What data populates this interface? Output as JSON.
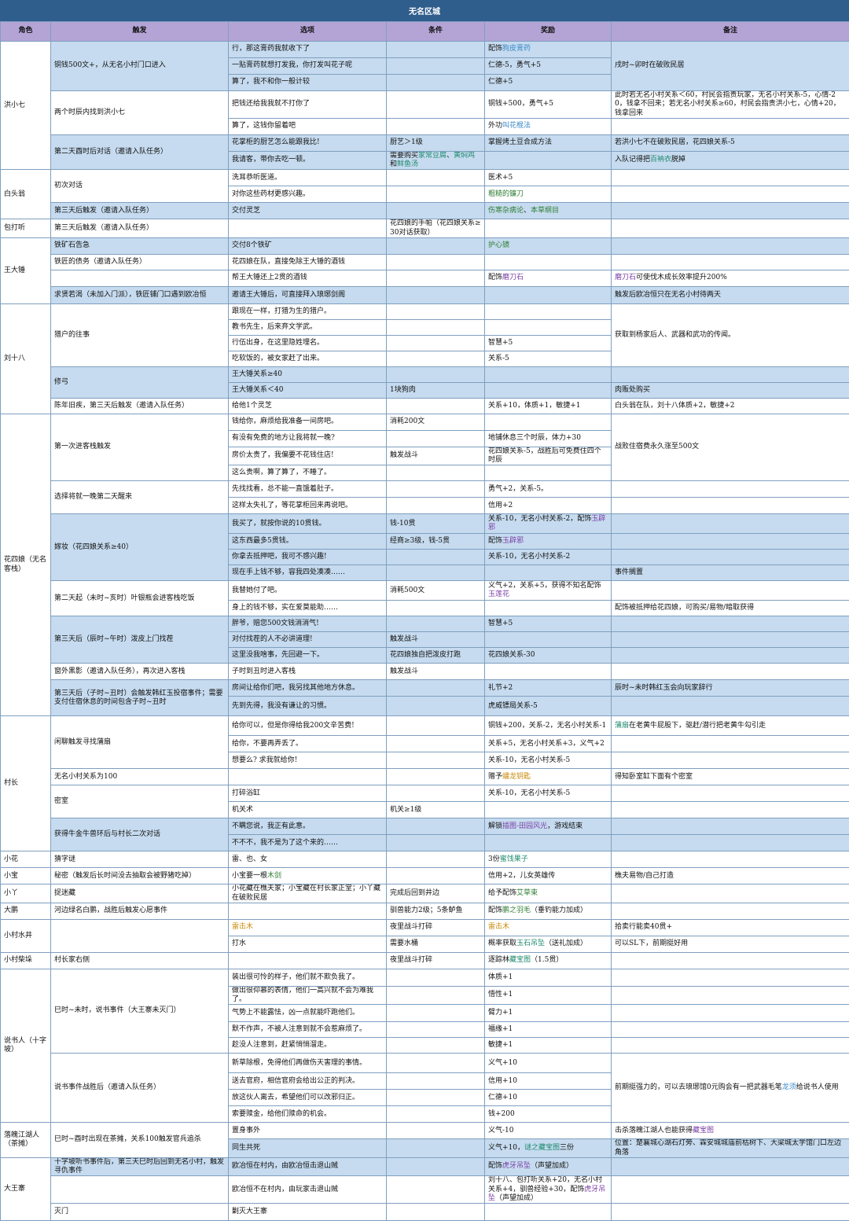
{
  "title": "无名区城",
  "columns": [
    "角色",
    "触发",
    "选项",
    "条件",
    "奖励",
    "备注"
  ],
  "roles": {
    "hong": "洪小七",
    "bai": "白头翁",
    "bao": "包打听",
    "wang": "王大锤",
    "liu": "刘十八",
    "hua": "花四娘（无名客栈）",
    "cun": "村长",
    "xiaohua": "小花",
    "xiaobao": "小宝",
    "xiaoya": "小丫",
    "dapeng": "大鹏",
    "shui": "小村水井",
    "chai": "小村柴垛",
    "shuo": "说书人（十字坡）",
    "luopo": "落魄江湖人（茶摊）",
    "dawang": "大王寨"
  },
  "rows": [
    {
      "t": "铜钱500文+，从无名小村门口进入",
      "o": "行，那这膏药我就收下了",
      "c": "",
      "r": [
        "配饰",
        {
          "s": "狗皮膏药",
          "k": "blue"
        }
      ],
      "n": "戌时~卯时在破败民居"
    },
    {
      "t": "",
      "o": "一贴膏药就想打发我，你打发叫花子呢",
      "c": "",
      "r": "仁德-5，勇气+5",
      "n": ""
    },
    {
      "t": "",
      "o": "算了，我不和你一般计较",
      "c": "",
      "r": "仁德+5",
      "n": ""
    },
    {
      "t": "两个时辰内找到洪小七",
      "o": "把钱还给我我就不打你了",
      "c": "",
      "r": "铜钱+500，勇气+5",
      "n": "此时若无名小村关系＜60，村民会指责玩家，无名小村关系-5，心情-20，钱拿不回来；若无名小村关系≥60，村民会指责洪小七，心情+20，钱拿回来"
    },
    {
      "t": "",
      "o": "算了，这钱你留着吧",
      "c": "",
      "r": [
        "外功",
        {
          "s": "叫花棍法",
          "k": "blue"
        }
      ],
      "n": ""
    },
    {
      "t": "第二天酉时后对话（邀请入队任务）",
      "o": "花掌柜的厨艺怎么能跟我比!",
      "c": "厨艺＞1级",
      "r": "掌握烤土豆合成方法",
      "n": "若洪小七不在破败民居，花四娘关系-5"
    },
    {
      "t": "",
      "o": "我请客，带你去吃一顿。",
      "c": [
        "需要购买",
        {
          "s": "家常豆腐",
          "k": "teal"
        },
        "、",
        {
          "s": "黄焖鸡",
          "k": "teal"
        },
        "和",
        {
          "s": "鲜鱼汤",
          "k": "teal"
        }
      ],
      "r": "",
      "n": [
        "入队记得把",
        {
          "s": "百衲衣",
          "k": "teal"
        },
        "脱掉"
      ]
    },
    {
      "t": "初次对话",
      "o": "洗耳恭听医道。",
      "c": "",
      "r": "医术+5",
      "n": ""
    },
    {
      "t": "",
      "o": "对你这些药材更感兴趣。",
      "c": "",
      "r": [
        {
          "s": "粗糙的镰刀",
          "k": "green"
        }
      ],
      "n": ""
    },
    {
      "t": "第三天后触发（邀请入队任务）",
      "o": "交付灵芝",
      "c": "",
      "r": [
        {
          "s": "伤寒杂病论",
          "k": "green"
        },
        "、",
        {
          "s": "本草纲目",
          "k": "green"
        }
      ],
      "n": ""
    },
    {
      "t": "第三天后触发（邀请入队任务）",
      "o": "",
      "c": "花四娘的手帕（花四娘关系≥30对话获取）",
      "r": "",
      "n": ""
    },
    {
      "t": "铁矿石告急",
      "o": "交付8个铁矿",
      "c": "",
      "r": [
        {
          "s": "护心镜",
          "k": "green"
        }
      ],
      "n": ""
    },
    {
      "t": "铁匠的债务（邀请入队任务）",
      "o": "花四娘在队，直接免除王大锤的酒钱",
      "c": "",
      "r": "",
      "n": ""
    },
    {
      "t": "",
      "o": "帮王大锤还上2贯的酒钱",
      "c": "",
      "r": [
        "配饰",
        {
          "s": "磨刀石",
          "k": "purple"
        }
      ],
      "n": [
        {
          "s": "磨刀石",
          "k": "purple"
        },
        "可使伐木成长效率提升200%"
      ]
    },
    {
      "t": "求贤若渴（未加入门派），铁匠铺门口遇到欧冶恒",
      "o": "邀请王大锤后，可直接拜入琅琊剑阁",
      "c": "",
      "r": "",
      "n": "触发后欧冶恒只在无名小村待两天"
    },
    {
      "t": "猎户的往事",
      "o": "跟现在一样，打猎为生的猎户。",
      "c": "",
      "r": "",
      "n": "获取到杨家后人、武器和武功的传闻。"
    },
    {
      "t": "",
      "o": "教书先生，后来弃文学武。",
      "c": "",
      "r": "",
      "n": ""
    },
    {
      "t": "",
      "o": "行伍出身，在这里隐姓埋名。",
      "c": "",
      "r": "智慧+5",
      "n": ""
    },
    {
      "t": "",
      "o": "吃软饭的，被女家赶了出来。",
      "c": "",
      "r": "关系-5",
      "n": ""
    },
    {
      "t": "修弓",
      "o": "王大锤关系≥40",
      "c": "",
      "r": "",
      "n": ""
    },
    {
      "t": "",
      "o": "王大锤关系＜40",
      "c": "1块狗肉",
      "r": "",
      "n": "肉贩处购买"
    },
    {
      "t": "陈年旧疾，第三天后触发（邀请入队任务）",
      "o": "给他1个灵芝",
      "c": "",
      "r": "关系+10，体质+1，敏捷+1",
      "n": "白头翁在队，刘十八体质+2，敏捷+2"
    },
    {
      "t": "第一次进客栈触发",
      "o": "钱给你，麻烦给我准备一间房吧。",
      "c": "消耗200文",
      "r": "",
      "n": "战败住宿费永久涨至500文"
    },
    {
      "t": "",
      "o": "有没有免费的地方让我将就一晚?",
      "c": "",
      "r": "地铺休息三个时辰，体力+30",
      "n": ""
    },
    {
      "t": "",
      "o": "房价太贵了，我偏要不花钱住店!",
      "c": "触发战斗",
      "r": "花四娘关系-5，战胜后可免费住四个时辰",
      "n": ""
    },
    {
      "t": "",
      "o": "这么贵啊，算了算了，不睡了。",
      "c": "",
      "r": "",
      "n": ""
    },
    {
      "t": "选择将就一晚第二天醒来",
      "o": "先找找看，总不能一直饿着肚子。",
      "c": "",
      "r": "勇气+2，关系-5。",
      "n": ""
    },
    {
      "t": "",
      "o": "这样太失礼了，等花掌柜回来再说吧。",
      "c": "",
      "r": "信用+2",
      "n": ""
    },
    {
      "t": "嫁妆（花四娘关系≥40）",
      "o": "我买了，就按你说的10贯钱。",
      "c": "钱-10贯",
      "r": [
        "关系-10，无名小村关系-2，配饰",
        {
          "s": "玉辟邪",
          "k": "purple"
        }
      ],
      "n": ""
    },
    {
      "t": "",
      "o": "这东西最多5贯钱。",
      "c": "经商≥3级，钱-5贯",
      "r": [
        "配饰",
        {
          "s": "玉辟邪",
          "k": "purple"
        }
      ],
      "n": ""
    },
    {
      "t": "",
      "o": "你拿去抵押吧，我可不感兴趣!",
      "c": "",
      "r": "关系-10，无名小村关系-2",
      "n": ""
    },
    {
      "t": "",
      "o": "现在手上钱不够，容我四处凑凑……",
      "c": "",
      "r": "",
      "n": "事件搁置"
    },
    {
      "t": "第二天起（未时~亥时）叶银瓶会进客栈吃饭",
      "o": "我替她付了吧。",
      "c": "消耗500文",
      "r": [
        "义气+2，关系+5，获得不知名配饰",
        {
          "s": "玉莲花",
          "k": "purple"
        }
      ],
      "n": ""
    },
    {
      "t": "",
      "o": "身上的钱不够，实在爱莫能助……",
      "c": "",
      "r": "",
      "n": "配饰被抵押给花四娘，可购买/易物/暗取获得"
    },
    {
      "t": "第三天后（辰时~午时）泼皮上门找茬",
      "o": "胖爷，赔您500文钱消消气!",
      "c": "",
      "r": "智慧+5",
      "n": ""
    },
    {
      "t": "",
      "o": "对付找茬的人不必讲道理!",
      "c": "触发战斗",
      "r": "",
      "n": ""
    },
    {
      "t": "",
      "o": "这里没我啥事，先回避一下。",
      "c": "花四娘独自把泼皮打跑",
      "r": "花四娘关系-30",
      "n": ""
    },
    {
      "t": "窗外黑影（邀请入队任务），再次进入客栈",
      "o": "子时到丑时进入客栈",
      "c": "触发战斗",
      "r": "",
      "n": ""
    },
    {
      "t": "第三天后（子时~丑时）会触发韩红玉投宿事件；需要支付住宿休息的时间包含子时~丑时",
      "o": "房间让给你们吧，我另找其他地方休息。",
      "c": "",
      "r": "礼节+2",
      "n": "辰时~未时韩红玉会向玩家辞行"
    },
    {
      "t": "",
      "o": "先到先得，我没有谦让的习惯。",
      "c": "",
      "r": "虎威镖局关系-5",
      "n": ""
    },
    {
      "t": "闲聊触发寻找蒲扇",
      "o": "给你可以，但是你得给我200文辛苦费!",
      "c": "",
      "r": "铜钱+200，关系-2，无名小村关系-1",
      "n": [
        {
          "s": "蒲扇",
          "k": "teal"
        },
        "在老黄牛屁股下，驱赶/潜行把老黄牛勾引走"
      ]
    },
    {
      "t": "",
      "o": "给你，不要再弄丢了。",
      "c": "",
      "r": "关系+5，无名小村关系+3，义气+2",
      "n": ""
    },
    {
      "t": "",
      "o": "想要么? 求我就给你!",
      "c": "",
      "r": "关系-10，无名小村关系-5",
      "n": ""
    },
    {
      "t": "无名小村关系为100",
      "o": "",
      "c": "",
      "r": [
        "赠予",
        {
          "s": "蟠龙钥匙",
          "k": "orange"
        }
      ],
      "n": "得知卧室缸下面有个密室"
    },
    {
      "t": "密室",
      "o": "打碎浴缸",
      "c": "",
      "r": "关系-10，无名小村关系-5",
      "n": ""
    },
    {
      "t": "",
      "o": "机关术",
      "c": "机关≥1级",
      "r": "",
      "n": ""
    },
    {
      "t": "获得牛金牛兽环后与村长二次对话",
      "o": "不瞒您说，我正有此意。",
      "c": "",
      "r": [
        "解锁",
        {
          "s": "插图-田园风光",
          "k": "purple"
        },
        "，游戏结束"
      ],
      "n": ""
    },
    {
      "t": "",
      "o": "不不不，我不是为了这个来的……",
      "c": "",
      "r": "",
      "n": ""
    },
    {
      "t": "猜字谜",
      "o": "雷、也、女",
      "c": "",
      "r": [
        "3份",
        {
          "s": "蜜饯果子",
          "k": "teal"
        }
      ],
      "n": ""
    },
    {
      "t": "秘密（触发后长时间没去抽取会被野猪吃掉）",
      "o": [
        "小宝要一根",
        {
          "s": "木剑",
          "k": "green"
        }
      ],
      "c": "",
      "r": "信用+2，儿女英雄传",
      "n": "樵夫易物/自己打造"
    },
    {
      "t": "捉迷藏",
      "o": "小花藏在樵夫家；小宝藏在村长家正堂；小丫藏在破败民居",
      "c": "完成后回到井边",
      "r": [
        "给予配饰",
        {
          "s": "艾草束",
          "k": "green"
        }
      ],
      "n": ""
    },
    {
      "t": "河边绿名白鹏，战胜后触发心愿事件",
      "o": "",
      "c": "驯兽能力2级；5条鲈鱼",
      "r": [
        "配饰",
        {
          "s": "鹏之羽毛",
          "k": "green"
        },
        "（垂钓能力加成）"
      ],
      "n": ""
    },
    {
      "t": "",
      "o": [
        {
          "s": "雷击木",
          "k": "orange"
        }
      ],
      "c": "夜里战斗打碎",
      "r": [
        {
          "s": "雷击木",
          "k": "orange"
        }
      ],
      "n": "拾卖行能卖40贯+"
    },
    {
      "t": "",
      "o": "打水",
      "c": "需要水桶",
      "r": [
        "概率获取",
        {
          "s": "玉石吊坠",
          "k": "teal"
        },
        "（送礼加成）"
      ],
      "n": "可以SL下，前期挺好用"
    },
    {
      "t": "村长家右侧",
      "o": "",
      "c": "夜里战斗打碎",
      "r": [
        "逐踪林",
        {
          "s": "藏宝图",
          "k": "teal"
        },
        "（1.5贯）"
      ],
      "n": ""
    },
    {
      "t": "巳时~未时，说书事件（大王寨未灭门）",
      "o": "装出很可怜的样子，他们就不欺负我了。",
      "c": "",
      "r": "体质+1",
      "n": ""
    },
    {
      "t": "",
      "o": "做出很仰慕的表情，他们一高兴就不会为难我了。",
      "c": "",
      "r": "悟性+1",
      "n": ""
    },
    {
      "t": "",
      "o": "气势上不能露怯，凶一点就能吓跑他们。",
      "c": "",
      "r": "臂力+1",
      "n": ""
    },
    {
      "t": "",
      "o": "默不作声，不被人注意到就不会惹麻烦了。",
      "c": "",
      "r": "福缘+1",
      "n": ""
    },
    {
      "t": "",
      "o": "趁没人注意到，赶紧悄悄溜走。",
      "c": "",
      "r": "敏捷+1",
      "n": ""
    },
    {
      "t": "说书事件战胜后（邀请入队任务）",
      "o": "新草除根，免得他们再做伤天害理的事情。",
      "c": "",
      "r": "义气+10",
      "n": [
        "前期挺强力的，可以去琅琊馆0元购会有一把武器毛笔",
        {
          "s": "龙须",
          "k": "blue"
        },
        "给说书人使用"
      ]
    },
    {
      "t": "",
      "o": "送去官府，相信官府会给出公正的判决。",
      "c": "",
      "r": "信用+10",
      "n": ""
    },
    {
      "t": "",
      "o": "放这伙人离去，希望他们可以改邪归正。",
      "c": "",
      "r": "仁德+10",
      "n": ""
    },
    {
      "t": "",
      "o": "索要赎金，给他们赎命的机会。",
      "c": "",
      "r": "钱+200",
      "n": ""
    },
    {
      "t": "巳时~酉时出现在茶摊，关系100触发官兵追杀",
      "o": "置身事外",
      "c": "",
      "r": "义气-10",
      "n": [
        "击杀落魄江湖人也能获得",
        {
          "s": "藏宝图",
          "k": "purple"
        }
      ]
    },
    {
      "t": "",
      "o": "同生共死",
      "c": "",
      "r": [
        "义气+10，",
        {
          "s": "谜之藏宝图",
          "k": "teal"
        },
        "三份"
      ],
      "n": "位置：楚襄城心湖石灯旁、霖安城城庙前枯树下、大梁城太学馆门口左边角落"
    },
    {
      "t": "十字坡听书事件后，第三天巳时后回到无名小村，触发寻仇事件",
      "o": "欧冶恒在村内，由欧冶恒击退山贼",
      "c": "",
      "r": [
        "配饰",
        {
          "s": "虎牙吊坠",
          "k": "purple"
        },
        "（声望加成）"
      ],
      "n": ""
    },
    {
      "t": "",
      "o": "欧冶恒不在村内，由玩家击退山贼",
      "c": "",
      "r": [
        "刘十八、包打听关系+20，无名小村关系+4，驯兽经验+30，配饰",
        {
          "s": "虎牙吊坠",
          "k": "purple"
        },
        "（声望加成）"
      ],
      "n": ""
    },
    {
      "t": "灭门",
      "o": "剿灭大王寨",
      "c": "",
      "r": "",
      "n": ""
    }
  ]
}
